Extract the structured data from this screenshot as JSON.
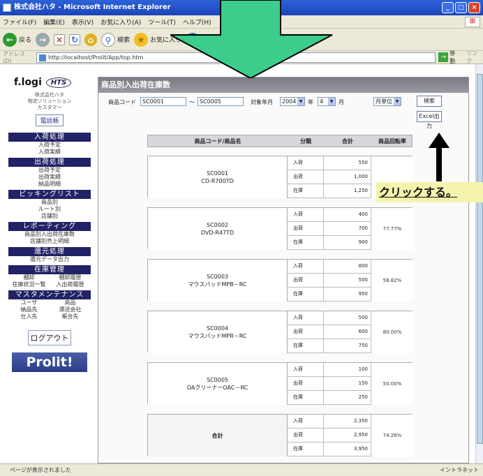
{
  "window": {
    "title": "株式会社ハタ - Microsoft Internet Explorer"
  },
  "menubar": {
    "items": [
      "ファイル(F)",
      "編集(E)",
      "表示(V)",
      "お気に入り(A)",
      "ツール(T)",
      "ヘルプ(H)"
    ]
  },
  "toolbar": {
    "back": "戻る",
    "search": "検索",
    "favorites": "お気に入り"
  },
  "addressbar": {
    "label": "アドレス(D)",
    "url": "http://localhost/Prolit/App/top.htm",
    "go": "移動",
    "links": "リンク"
  },
  "statusbar": {
    "text": "ページが表示されました",
    "zone": "イントラネット"
  },
  "sidebar": {
    "logo_text": "f.logi",
    "logo_badge": "HTS",
    "company": [
      "株式会社ハタ",
      "物流ソリューション",
      "カスタマー"
    ],
    "top_button": "電話帳",
    "sections": [
      {
        "title": "入荷処理",
        "items": [
          "入荷予定",
          "入荷実績"
        ]
      },
      {
        "title": "出荷処理",
        "items": [
          "出荷予定",
          "出荷実績",
          "納品明細"
        ]
      },
      {
        "title": "ピッキングリスト",
        "items": [
          "商品別",
          "ルート別",
          "店舗別"
        ]
      },
      {
        "title": "レポーティング",
        "items": [
          "商品別入出荷在庫数",
          "店舗別売上明細"
        ]
      },
      {
        "title": "還元処理",
        "items": [
          "還元データ出力"
        ]
      }
    ],
    "stock_title": "在庫管理",
    "stock_items": [
      "棚卸",
      "棚卸履歴",
      "在庫状況一覧",
      "入出荷履歴"
    ],
    "master_title": "マスタメンテナンス",
    "master_items": [
      "ユーザ",
      "商品",
      "納品先",
      "運送会社",
      "仕入先",
      "帳合先"
    ],
    "logout": "ログアウト",
    "brand": "Prolit!"
  },
  "panel": {
    "title": "商品別入出荷在庫数",
    "code_label": "商品コード",
    "code_from": "SC0001",
    "code_sep": "～",
    "code_to": "SC0005",
    "period_label": "対象年月",
    "year": "2004",
    "year_unit": "年",
    "month": "4",
    "month_unit": "月",
    "unit_select": "月単位",
    "search_button": "検索",
    "excel_button": "Excel出力"
  },
  "table": {
    "headers": [
      "商品コード/商品名",
      "分類",
      "合計",
      "商品回転率"
    ],
    "groups": [
      {
        "code": "SC0001",
        "name": "CD-R700TD",
        "in": "550",
        "out": "1,000",
        "stock": "1,250",
        "rate": ""
      },
      {
        "code": "SC0002",
        "name": "DVD-R47TD",
        "in": "400",
        "out": "700",
        "stock": "900",
        "rate": "77.77%"
      },
      {
        "code": "SC0003",
        "name": "マウスパッドMPB－RC",
        "in": "800",
        "out": "500",
        "stock": "950",
        "rate": "58.82%"
      },
      {
        "code": "SC0004",
        "name": "マウスパッドMPR－RC",
        "in": "500",
        "out": "600",
        "stock": "750",
        "rate": "80.00%"
      },
      {
        "code": "SC0005",
        "name": "OAクリーナーOAC－RC",
        "in": "100",
        "out": "150",
        "stock": "250",
        "rate": "50.00%"
      }
    ],
    "total": {
      "label": "合計",
      "in": "2,350",
      "out": "2,950",
      "stock": "3,950",
      "rate": "74.26%"
    },
    "kinds": [
      "入荷",
      "出荷",
      "在庫"
    ]
  },
  "annotation": {
    "click_label": "クリックする。",
    "arrow_color": "#3ccc8c"
  }
}
